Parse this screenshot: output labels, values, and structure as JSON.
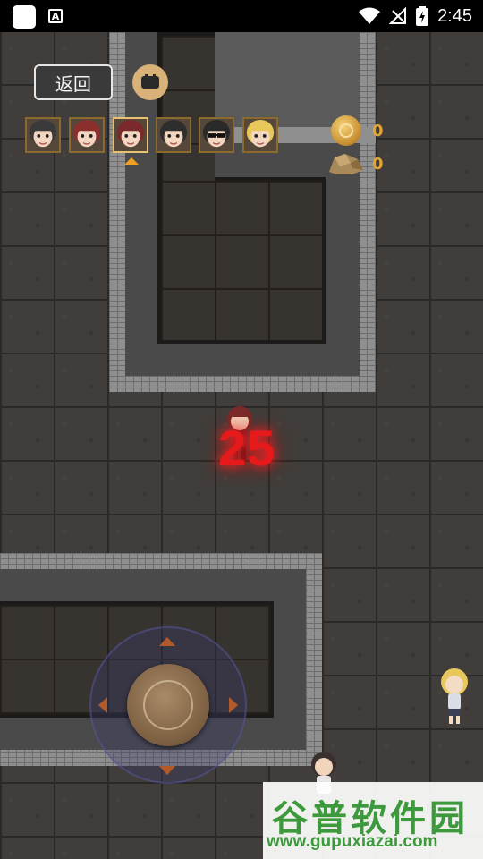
{
  "statusbar": {
    "time": "2:45",
    "notification_icon": "A"
  },
  "hud": {
    "back_label": "返回",
    "coin_count": "0",
    "ore_count": "0",
    "selected_character_index": 2,
    "characters": [
      {
        "id": "char-1",
        "hair": "#3a3a3a"
      },
      {
        "id": "char-2",
        "hair": "#8b2e2e"
      },
      {
        "id": "char-3",
        "hair": "#7a2a2a"
      },
      {
        "id": "char-4",
        "hair": "#2e2e2e"
      },
      {
        "id": "char-5",
        "hair": "#2a2a2a",
        "sunglasses": true
      },
      {
        "id": "char-6",
        "hair": "#e8c85a"
      }
    ]
  },
  "game": {
    "damage_number": "25"
  },
  "watermark": {
    "main": "谷普软件园",
    "url": "www.gupuxiazai.com"
  },
  "colors": {
    "accent": "#e0a437",
    "damage": "#e61a1a",
    "watermark": "#3c9a3c"
  }
}
